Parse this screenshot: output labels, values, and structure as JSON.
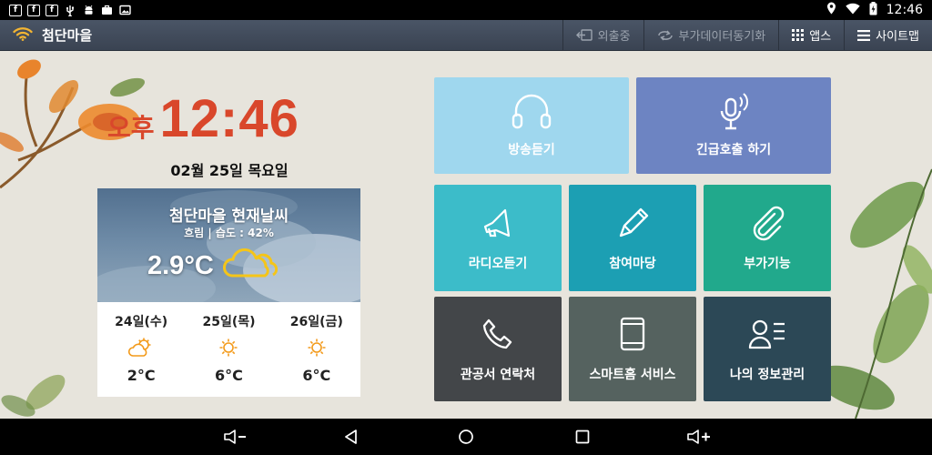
{
  "status_bar": {
    "time": "12:46",
    "left_icons": [
      "facebook-icon",
      "facebook-icon",
      "facebook-icon",
      "usb-icon",
      "android-icon",
      "briefcase-icon",
      "photo-icon"
    ],
    "right_icons": [
      "location-icon",
      "wifi-icon",
      "battery-charging-icon"
    ]
  },
  "header": {
    "app_title": "첨단마을",
    "actions": [
      {
        "label": "외출중",
        "icon": "away-icon",
        "enabled": false
      },
      {
        "label": "부가데이터동기화",
        "icon": "sync-icon",
        "enabled": false
      },
      {
        "label": "앱스",
        "icon": "grid-icon",
        "enabled": true
      },
      {
        "label": "사이트맵",
        "icon": "menu-icon",
        "enabled": true
      }
    ]
  },
  "clock": {
    "ampm": "오후",
    "time": "12:46",
    "date": "02월 25일 목요일"
  },
  "weather": {
    "title": "첨단마을 현재날씨",
    "condition": "흐림 | 습도 : 42%",
    "temperature": "2.9°C",
    "current_icon": "cloudy-icon",
    "forecast": [
      {
        "day": "24일(수)",
        "icon": "partly-cloudy-icon",
        "temp": "2°C"
      },
      {
        "day": "25일(목)",
        "icon": "sunny-icon",
        "temp": "6°C"
      },
      {
        "day": "26일(금)",
        "icon": "sunny-icon",
        "temp": "6°C"
      }
    ]
  },
  "tiles": {
    "broadcast": {
      "label": "방송듣기",
      "icon": "headphones-icon",
      "color": "#9fd7ee"
    },
    "emergency": {
      "label": "긴급호출 하기",
      "icon": "microphone-icon",
      "color": "#6d84c2"
    },
    "radio": {
      "label": "라디오듣기",
      "icon": "speaker-icon",
      "color": "#3cbcc9"
    },
    "participation": {
      "label": "참여마당",
      "icon": "pencil-icon",
      "color": "#1c9fb3"
    },
    "extra": {
      "label": "부가기능",
      "icon": "paperclip-icon",
      "color": "#21a98c"
    },
    "contacts": {
      "label": "관공서 연락처",
      "icon": "phone-icon",
      "color": "#434649"
    },
    "smarthome": {
      "label": "스마트홈 서비스",
      "icon": "tablet-icon",
      "color": "#55625f"
    },
    "myinfo": {
      "label": "나의 정보관리",
      "icon": "user-list-icon",
      "color": "#2c4856"
    }
  },
  "nav_bar": {
    "buttons": [
      "volume-down-icon",
      "back-icon",
      "home-icon",
      "recents-icon",
      "volume-up-icon"
    ]
  }
}
